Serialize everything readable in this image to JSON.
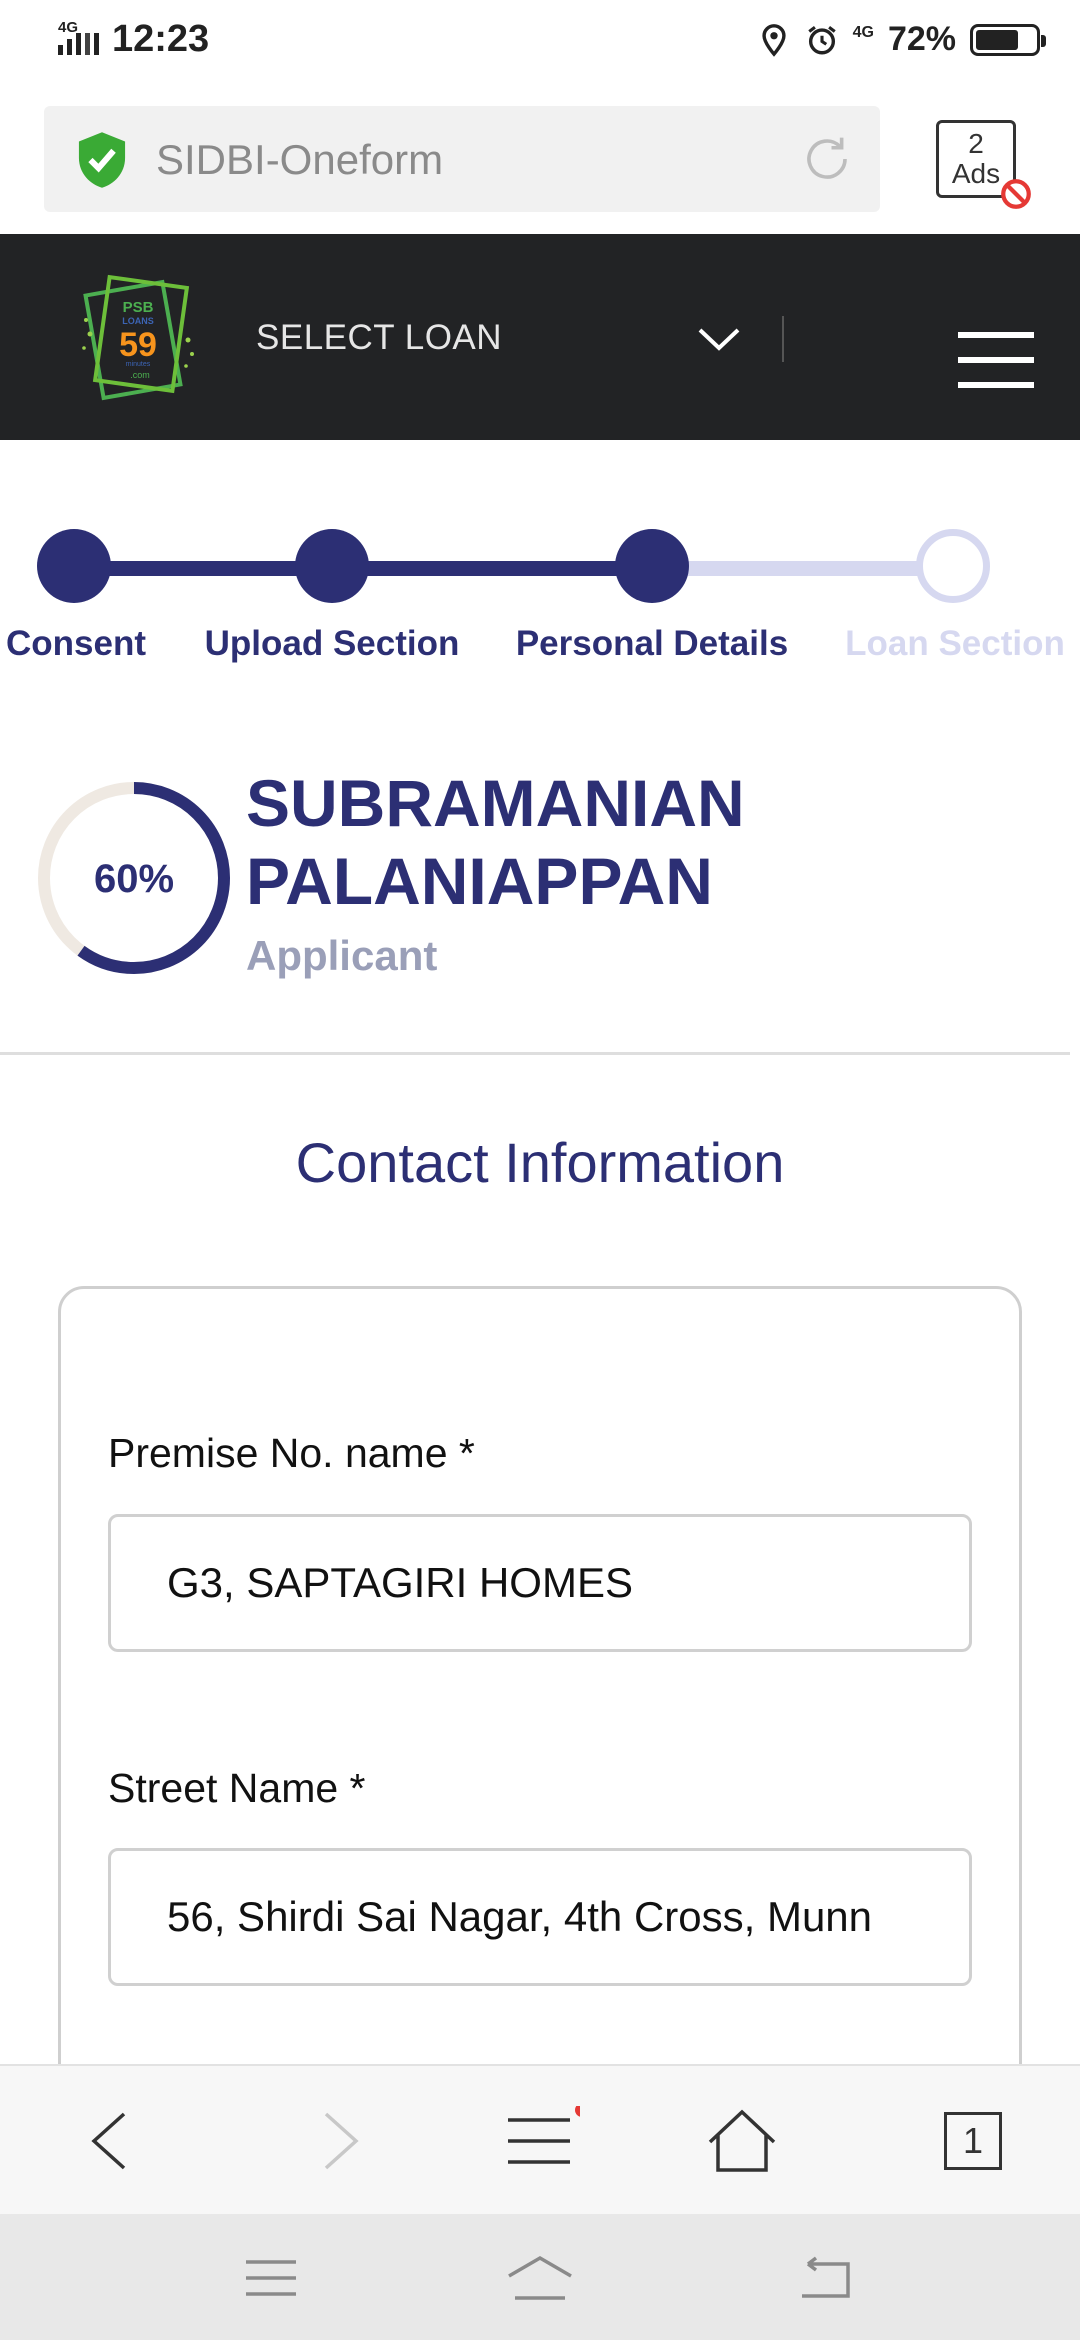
{
  "status_bar": {
    "network": "4G",
    "time": "12:23",
    "net_type_right": "4G",
    "battery_percent": "72%",
    "battery_level": 0.72
  },
  "address_bar": {
    "url_text": "SIDBI-Oneform",
    "ads_count": "2",
    "ads_label": "Ads"
  },
  "header": {
    "logo": {
      "line1": "PSB",
      "line2": "LOANS",
      "number": "59",
      "suffix": "minutes",
      "domain": ".com"
    },
    "select_label": "SELECT LOAN"
  },
  "stepper": {
    "steps": [
      {
        "label": "Consent",
        "state": "done"
      },
      {
        "label": "Upload Section",
        "state": "done"
      },
      {
        "label": "Personal Details",
        "state": "done"
      },
      {
        "label": "Loan Section",
        "state": "pending"
      }
    ],
    "colors": {
      "active": "#2c2f74",
      "inactive": "#d6d8f0"
    }
  },
  "applicant": {
    "progress_label": "60%",
    "progress": 0.6,
    "name_line1": "SUBRAMANIAN",
    "name_line2": "PALANIAPPAN",
    "role": "Applicant"
  },
  "section": {
    "title": "Contact Information",
    "fields": [
      {
        "label": "Premise No. name *",
        "value": "G3, SAPTAGIRI HOMES"
      },
      {
        "label": "Street Name *",
        "value": "56, Shirdi Sai Nagar, 4th Cross, Munn"
      }
    ]
  },
  "browser_toolbar": {
    "tab_count": "1"
  },
  "icons": [
    "signal-icon",
    "location-icon",
    "alarm-icon",
    "battery-icon",
    "shield-check-icon",
    "reload-icon",
    "ad-block-icon",
    "chevron-down-icon",
    "hamburger-menu-icon",
    "back-icon",
    "forward-icon",
    "menu-icon",
    "home-icon",
    "tabs-icon",
    "recent-apps-icon",
    "system-home-icon",
    "system-back-icon"
  ]
}
